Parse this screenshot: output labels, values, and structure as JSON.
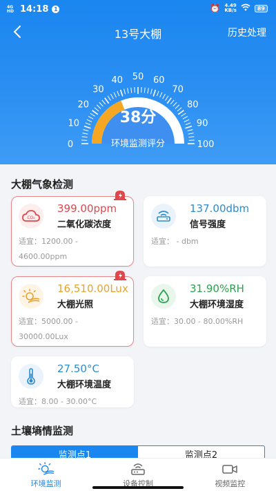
{
  "statusbar": {
    "network": "4G HD",
    "time": "14:18",
    "notification_badge": "1",
    "speed_value": "4.49",
    "speed_unit": "KB/s",
    "battery": "89"
  },
  "header": {
    "title": "13号大棚",
    "history_label": "历史处理"
  },
  "gauge": {
    "score_text": "38分",
    "score_value": 38,
    "label": "环境监测评分",
    "min": 0,
    "max": 100,
    "ticks": [
      "0",
      "10",
      "20",
      "30",
      "40",
      "50",
      "60",
      "70",
      "80",
      "90",
      "100"
    ],
    "accent_color": "#f5a623"
  },
  "weather_section": {
    "title": "大棚气象检测",
    "cards": [
      {
        "value": "399.00ppm",
        "name": "二氧化碳浓度",
        "range_label": "适宜：",
        "range_line1": "1200.00 -",
        "range_line2": "4600.00ppm",
        "value_color": "#e0474c",
        "icon": "co2-cloud-icon",
        "alarm": true
      },
      {
        "value": "137.00dbm",
        "name": "信号强度",
        "range_label": "适宜：",
        "range_line1": " - dbm",
        "range_line2": "",
        "value_color": "#2a8ccf",
        "icon": "signal-router-icon",
        "alarm": false
      },
      {
        "value": "16,510.00Lux",
        "name": "大棚光照",
        "range_label": "适宜：",
        "range_line1": "5000.00 -",
        "range_line2": "30000.00Lux",
        "value_color": "#e9a32d",
        "icon": "sun-light-icon",
        "alarm": true
      },
      {
        "value": "31.90%RH",
        "name": "大棚环境湿度",
        "range_label": "适宜：",
        "range_line1": "30.00 - 80.00%RH",
        "range_line2": "",
        "value_color": "#2aa24b",
        "icon": "humidity-drop-icon",
        "alarm": false
      },
      {
        "value": "27.50°C",
        "name": "大棚环境温度",
        "range_label": "适宜：",
        "range_line1": "8.00 - 30.00°C",
        "range_line2": "",
        "value_color": "#2a8ccf",
        "icon": "thermometer-icon",
        "alarm": false
      }
    ]
  },
  "soil_section": {
    "title": "土壤墒情监测",
    "tabs": [
      {
        "label": "监测点1",
        "active": true
      },
      {
        "label": "监测点2",
        "active": false
      }
    ]
  },
  "bottom_nav": [
    {
      "label": "环境监测",
      "icon": "environment-sun-icon",
      "active": true
    },
    {
      "label": "设备控制",
      "icon": "router-device-icon",
      "active": false
    },
    {
      "label": "视频监控",
      "icon": "video-camera-icon",
      "active": false
    }
  ]
}
